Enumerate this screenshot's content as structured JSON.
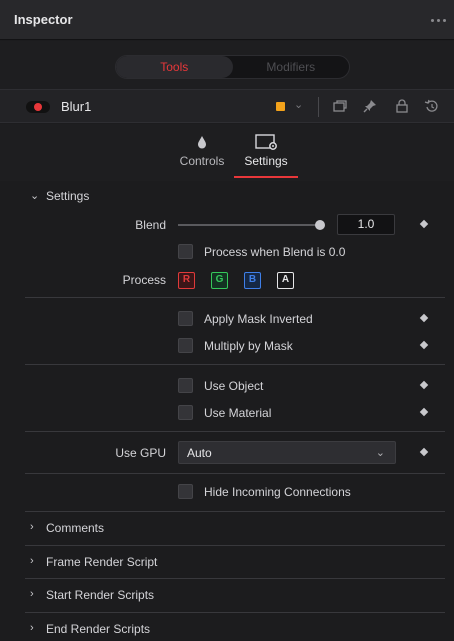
{
  "panel": {
    "title": "Inspector"
  },
  "tabs": {
    "tools": "Tools",
    "modifiers": "Modifiers"
  },
  "tool": {
    "name": "Blur1",
    "color": "#f3a21b",
    "enabled": true
  },
  "subtabs": {
    "controls": "Controls",
    "settings": "Settings",
    "active": "Settings"
  },
  "settings": {
    "header": "Settings",
    "blend": {
      "label": "Blend",
      "value": "1.0",
      "fraction": 1.0
    },
    "process_when_blend_zero": {
      "label": "Process when Blend is 0.0",
      "checked": false
    },
    "process": {
      "label": "Process",
      "channels": [
        {
          "label": "R",
          "color": "#e03a3a"
        },
        {
          "label": "G",
          "color": "#35c85a"
        },
        {
          "label": "B",
          "color": "#3f7fe8"
        },
        {
          "label": "A",
          "color": "#e6e6e8"
        }
      ]
    },
    "apply_mask_inverted": {
      "label": "Apply Mask Inverted",
      "checked": false
    },
    "multiply_by_mask": {
      "label": "Multiply by Mask",
      "checked": false
    },
    "use_object": {
      "label": "Use Object",
      "checked": false
    },
    "use_material": {
      "label": "Use Material",
      "checked": false
    },
    "use_gpu": {
      "label": "Use GPU",
      "value": "Auto"
    },
    "hide_incoming": {
      "label": "Hide Incoming Connections",
      "checked": false
    }
  },
  "collapsed_sections": [
    {
      "label": "Comments"
    },
    {
      "label": "Frame Render Script"
    },
    {
      "label": "Start Render Scripts"
    },
    {
      "label": "End Render Scripts"
    }
  ],
  "icons": {
    "more": "more-dots-icon",
    "controls": "droplet-icon",
    "settings": "settings-window-icon",
    "header_tools": [
      "copy-icon",
      "pin-icon",
      "lock-icon",
      "reset-icon"
    ]
  }
}
